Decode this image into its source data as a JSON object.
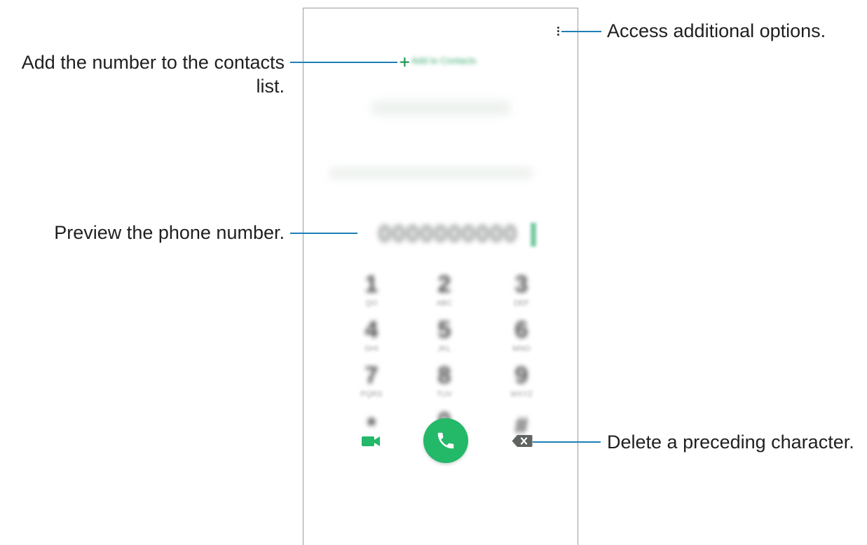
{
  "callouts": {
    "add_contact": "Add the number to the contacts\nlist.",
    "more_options": "Access additional options.",
    "preview_number": "Preview the phone number.",
    "delete_character": "Delete a preceding character."
  },
  "dialer": {
    "add_label": "Add to Contacts",
    "number_preview": "0000000000",
    "keys": [
      {
        "digit": "1",
        "letters": "QO"
      },
      {
        "digit": "2",
        "letters": "ABC"
      },
      {
        "digit": "3",
        "letters": "DEF"
      },
      {
        "digit": "4",
        "letters": "GHI"
      },
      {
        "digit": "5",
        "letters": "JKL"
      },
      {
        "digit": "6",
        "letters": "MNO"
      },
      {
        "digit": "7",
        "letters": "PQRS"
      },
      {
        "digit": "8",
        "letters": "TUV"
      },
      {
        "digit": "9",
        "letters": "WXYZ"
      },
      {
        "digit": "*",
        "letters": ""
      },
      {
        "digit": "0",
        "letters": "+"
      },
      {
        "digit": "#",
        "letters": ""
      }
    ],
    "icons": {
      "more": "more-options-icon",
      "add": "plus-icon",
      "video": "video-call-icon",
      "call": "phone-call-icon",
      "backspace": "backspace-icon"
    },
    "colors": {
      "accent": "#24b869",
      "leader": "#1d7fb7"
    }
  }
}
